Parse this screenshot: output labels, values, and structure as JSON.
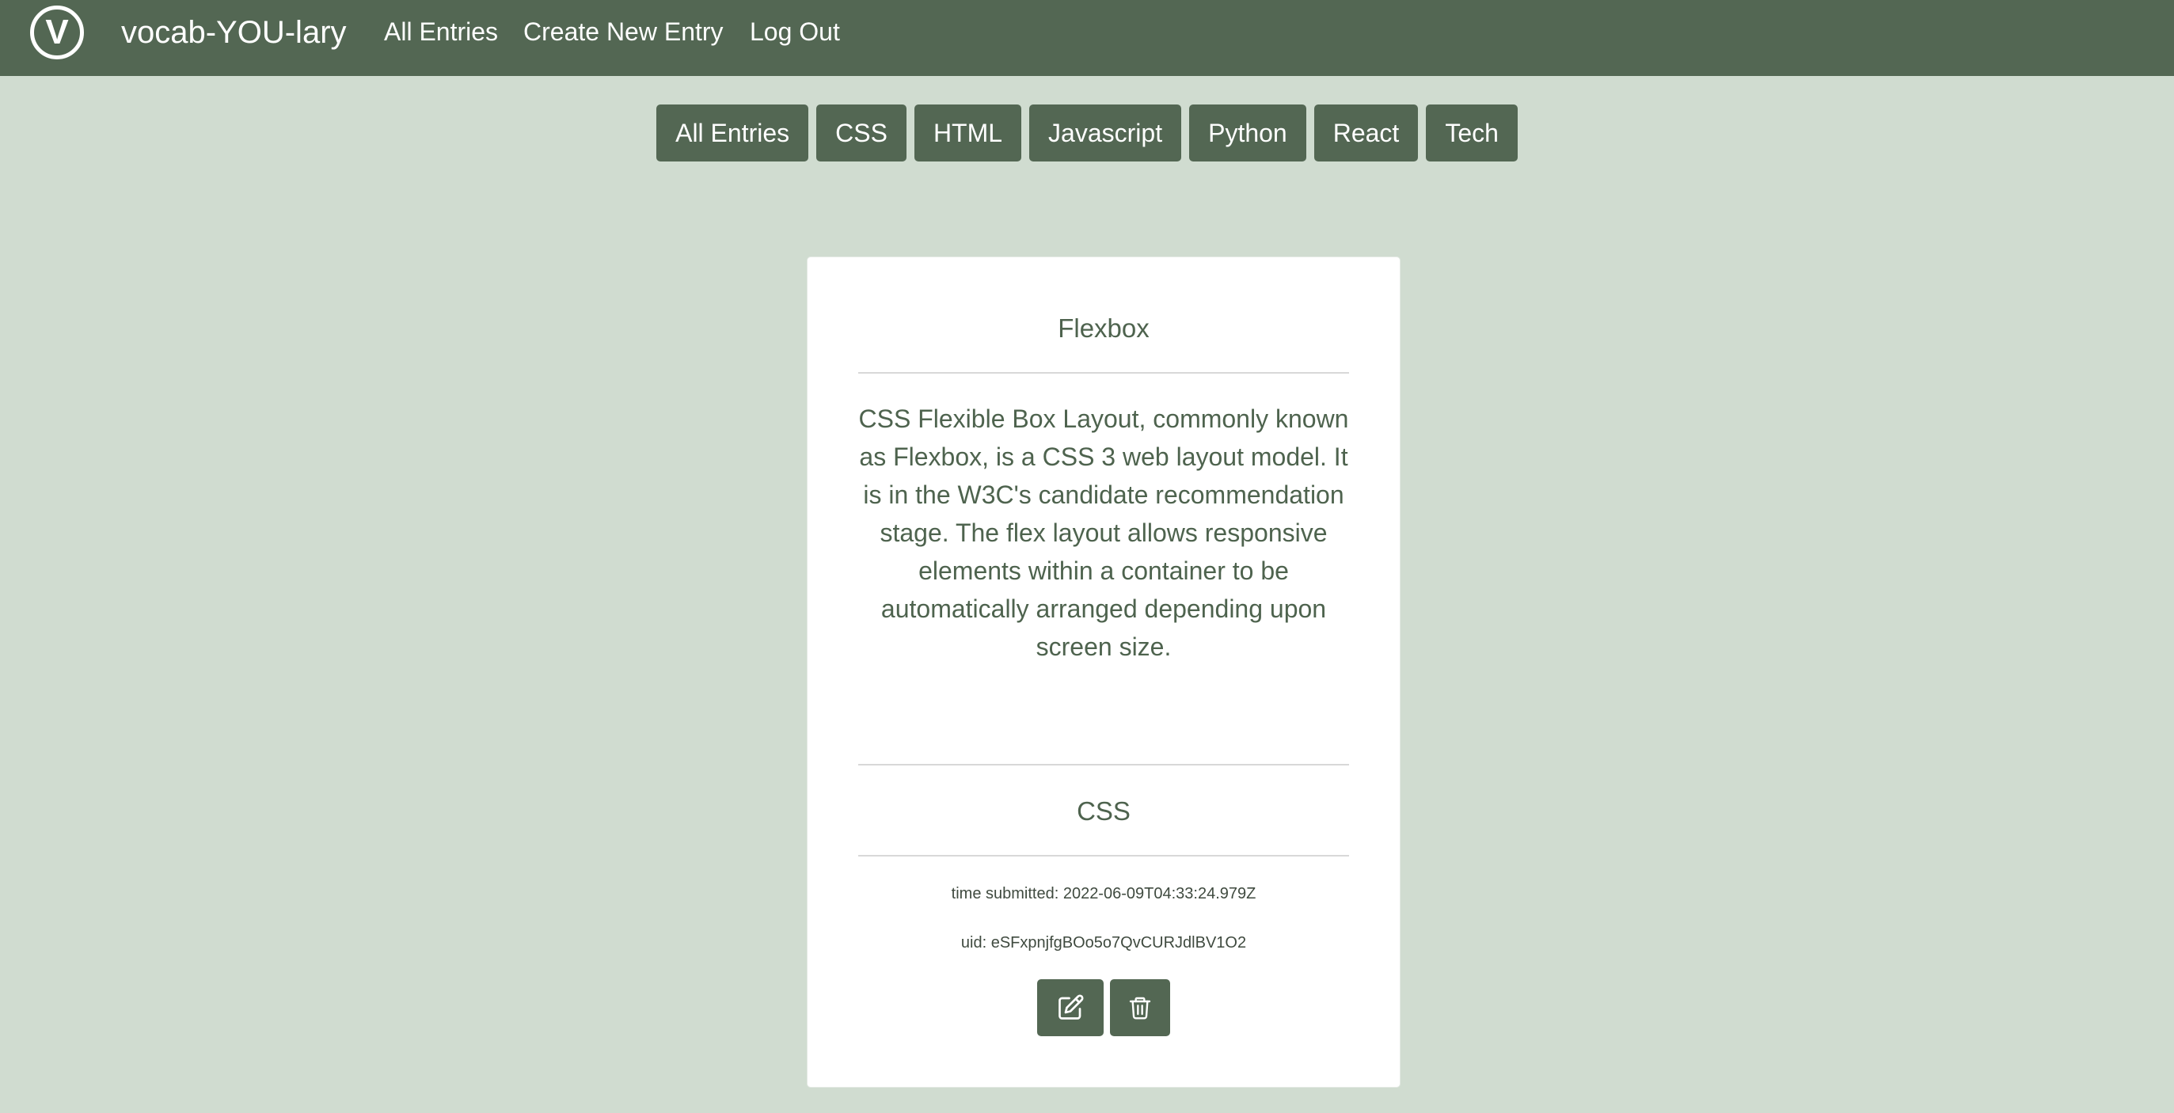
{
  "navbar": {
    "logo_letter": "V",
    "brand": "vocab-YOU-lary",
    "links": [
      "All Entries",
      "Create New Entry",
      "Log Out"
    ]
  },
  "filters": [
    "All Entries",
    "CSS",
    "HTML",
    "Javascript",
    "Python",
    "React",
    "Tech"
  ],
  "entry": {
    "title": "Flexbox",
    "definition": "CSS Flexible Box Layout, commonly known as Flexbox, is a CSS 3 web layout model. It is in the W3C's candidate recommendation stage. The flex layout allows responsive elements within a container to be automatically arranged depending upon screen size.",
    "category": "CSS",
    "time_submitted": "time submitted: 2022-06-09T04:33:24.979Z",
    "uid": "uid: eSFxpnjfgBOo5o7QvCURJdlBV1O2",
    "actions": [
      {
        "icon": "edit-icon"
      },
      {
        "icon": "trash-icon"
      }
    ]
  },
  "colors": {
    "navbar": "#536753",
    "background": "#d0dcd0",
    "card": "#ffffff",
    "text": "#4e634e"
  }
}
